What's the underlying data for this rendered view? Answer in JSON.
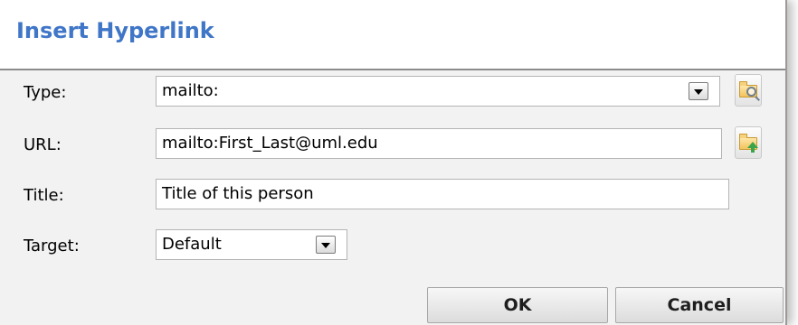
{
  "dialog": {
    "title": "Insert Hyperlink"
  },
  "form": {
    "type": {
      "label": "Type:",
      "value": "mailto:",
      "icon": "browse-search-icon"
    },
    "url": {
      "label": "URL:",
      "value": "mailto:First_Last@uml.edu",
      "icon": "upload-folder-icon"
    },
    "title": {
      "label": "Title:",
      "value": "Title of this person"
    },
    "target": {
      "label": "Target:",
      "value": "Default"
    }
  },
  "buttons": {
    "ok": "OK",
    "cancel": "Cancel"
  },
  "colors": {
    "title": "#3f76c7",
    "body_background": "#f2f2f2"
  }
}
